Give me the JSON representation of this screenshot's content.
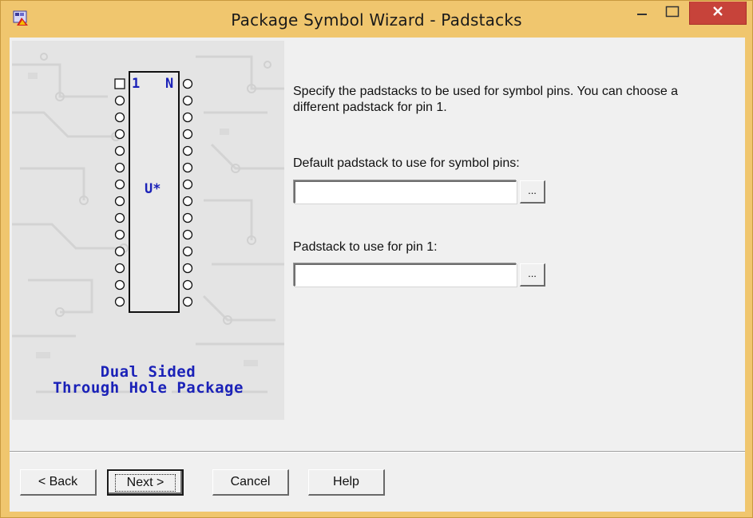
{
  "window": {
    "title": "Package Symbol Wizard - Padstacks",
    "colors": {
      "frame": "#f0c66e",
      "close": "#c7433a",
      "accent_text": "#1b22b8"
    }
  },
  "icons": {
    "app": "wizard-app-icon",
    "minimize": "minimize-icon",
    "maximize": "maximize-icon",
    "close": "close-icon"
  },
  "illustration": {
    "pin1_label": "1",
    "pinN_label": "N",
    "refdes_label": "U*",
    "pins_per_side": 14,
    "caption_line1": "Dual Sided",
    "caption_line2": "Through Hole Package"
  },
  "main": {
    "instructions": "Specify the padstacks to be used for symbol pins. You can choose a different padstack for pin 1.",
    "default_padstack": {
      "label": "Default padstack to use for symbol pins:",
      "value": "",
      "browse_label": "..."
    },
    "pin1_padstack": {
      "label": "Padstack to use for pin 1:",
      "value": "",
      "browse_label": "..."
    }
  },
  "buttons": {
    "back": "< Back",
    "next": "Next >",
    "cancel": "Cancel",
    "help": "Help"
  }
}
